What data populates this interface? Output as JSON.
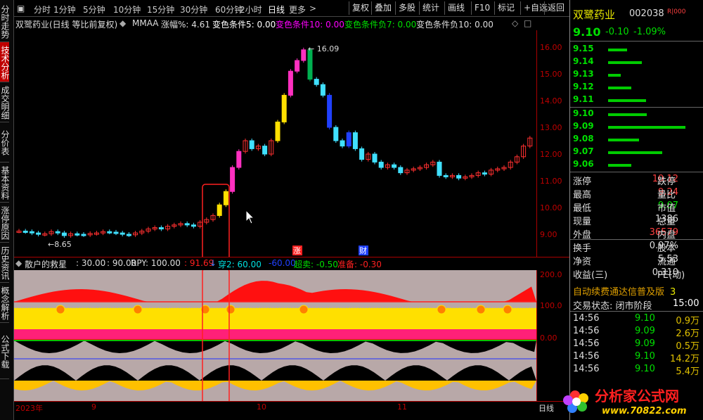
{
  "side_tabs": [
    "分时走势",
    "技术分析",
    "成交明细",
    "分价表",
    "基本资料",
    "涨停原因",
    "历史资讯",
    "概念解析",
    "公式下载"
  ],
  "top": {
    "periods": [
      "分时",
      "1分钟",
      "5分钟",
      "10分钟",
      "15分钟",
      "30分钟",
      "60分钟",
      "2小时",
      "日线",
      "更多"
    ],
    "selected": "日线",
    "buttons": [
      "复权",
      "叠加",
      "多股",
      "统计",
      "画线",
      "F10",
      "标记",
      "+自选",
      "返回"
    ]
  },
  "info": {
    "title": "双鹭药业(日线 等比前复权)",
    "mmaa": "MMAA",
    "zf": "涨幅%: 4.61",
    "up5": "变色条件5: 0.00",
    "up10": "变色条件10: 0.00",
    "dn7": "变色条件负7: 0.00",
    "dn10": "变色条件负10: 0.00"
  },
  "chart_data": {
    "type": "candlestick",
    "high_label": "16.09",
    "low_label": "8.65",
    "y_ticks": [
      "16.00",
      "15.00",
      "14.00",
      "13.00",
      "12.00",
      "11.00",
      "10.00",
      "9.00"
    ],
    "markers": [
      "涨",
      "财"
    ]
  },
  "indicator": {
    "name": "散户的救星",
    "v1": ": 30.00",
    "v2": ": 90.00",
    "rpy": "RPY: 100.00",
    "v3": ": 91.69",
    "sym": "↓",
    "chuan": "穿2: 60.00",
    "neg": "-60.00",
    "chaomai": "超卖: -0.50",
    "zhunbei": "准备: -0.30",
    "y_ticks": [
      "200.0",
      "100.0",
      "0.00"
    ]
  },
  "x_axis": {
    "labels": [
      "2023年",
      "9",
      "10",
      "11"
    ],
    "corner": "日线"
  },
  "quote": {
    "name": "双鹭药业",
    "code": "002038",
    "badge": "R|000",
    "price": "9.10",
    "chg": "-0.10",
    "pct": "-1.09%"
  },
  "asks": [
    {
      "p": "9.15",
      "v": 0.45
    },
    {
      "p": "9.14",
      "v": 0.8
    },
    {
      "p": "9.13",
      "v": 0.3
    },
    {
      "p": "9.12",
      "v": 0.55
    },
    {
      "p": "9.11",
      "v": 0.9
    }
  ],
  "bids": [
    {
      "p": "9.10",
      "v": 0.5
    },
    {
      "p": "9.09",
      "v": 1.0
    },
    {
      "p": "9.08",
      "v": 0.4
    },
    {
      "p": "9.07",
      "v": 0.7
    },
    {
      "p": "9.06",
      "v": 0.3
    }
  ],
  "stats": [
    {
      "l": "涨停",
      "v": "10.12",
      "c": "#ff4040",
      "r": "跌停"
    },
    {
      "l": "最高",
      "v": "9.24",
      "c": "#ff4040",
      "r": "量比"
    },
    {
      "l": "最低",
      "v": "9.07",
      "c": "#00e000",
      "r": "市值"
    },
    {
      "l": "现量",
      "v": "1386",
      "c": "#ddd",
      "r": "总量"
    },
    {
      "l": "外盘",
      "v": "36579",
      "c": "#ff4040",
      "r": "内盘"
    },
    {
      "l": "换手",
      "v": "0.97%",
      "c": "#ddd",
      "r": "股本"
    },
    {
      "l": "净资",
      "v": "5.53",
      "c": "#ddd",
      "r": "流通"
    },
    {
      "l": "收益(三)",
      "v": "0.310",
      "c": "#ddd",
      "r": "PE(动)"
    }
  ],
  "promo": "自动续费通达信普及版",
  "promo_n": "3",
  "status": {
    "label": "交易状态: 闭市阶段",
    "time": "15:00"
  },
  "ticks": [
    {
      "t": "14:56",
      "p": "9.10",
      "v": "0.9万"
    },
    {
      "t": "14:56",
      "p": "9.09",
      "v": "2.6万"
    },
    {
      "t": "14:56",
      "p": "9.09",
      "v": "0.5万"
    },
    {
      "t": "14:56",
      "p": "9.10",
      "v": "14.2万"
    },
    {
      "t": "14:56",
      "p": "9.10",
      "v": "5.4万"
    }
  ],
  "watermark": "分析家公式网",
  "watermark_url": "www.70822.com"
}
